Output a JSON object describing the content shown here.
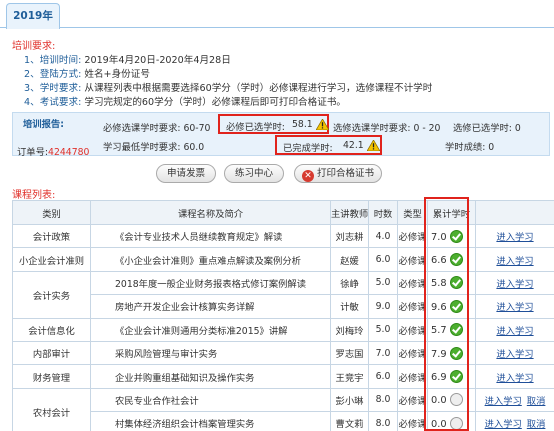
{
  "tab": {
    "label": "2019年"
  },
  "requirements": {
    "title": "培训要求:",
    "items": [
      {
        "label": "1、培训时间:",
        "value": " 2019年4月20日-2020年4月28日"
      },
      {
        "label": "2、登陆方式:",
        "value": " 姓名+身份证号"
      },
      {
        "label": "3、学时要求:",
        "value": " 从课程列表中根据需要选择60学分（学时）必修课程进行学习，选修课程不计学时"
      },
      {
        "label": "4、考试要求:",
        "value": " 学习完规定的60学分（学时）必修课程后即可打印合格证书。"
      }
    ]
  },
  "report": {
    "label": "培训报告:",
    "order_label": "订单号:",
    "order_number": "4244780",
    "required_select_req": "必修选课学时要求: 60-70",
    "required_selected_label": "必修已选学时:",
    "required_selected_value": "58.1",
    "elective_select_req": "选修选课学时要求: 0 - 20",
    "elective_selected": "选修已选学时: 0",
    "min_credits": "学习最低学时要求:  60.0",
    "completed_label": "已完成学时:",
    "completed_value": "42.1",
    "score": "学时成绩:  0"
  },
  "buttons": {
    "invoice": "申请发票",
    "practice": "练习中心",
    "print": "打印合格证书"
  },
  "list": {
    "title": "课程列表:",
    "headers": [
      "类别",
      "课程名称及简介",
      "主讲教师",
      "时数",
      "类型",
      "累计学时",
      ""
    ],
    "rows": [
      {
        "category": "会计政策",
        "name": "《会计专业技术人员继续教育规定》解读",
        "teacher": "刘志耕",
        "time": "4.0",
        "type": "必修课",
        "hours": "7.0",
        "done": true,
        "action": "进入学习",
        "cancel": ""
      },
      {
        "category": "小企业会计准则",
        "name": "《小企业会计准则》重点难点解读及案例分析",
        "teacher": "赵媛",
        "time": "6.0",
        "type": "必修课",
        "hours": "6.6",
        "done": true,
        "action": "进入学习",
        "cancel": ""
      },
      {
        "category": "会计实务",
        "name": "2018年度一般企业财务报表格式修订案例解读",
        "teacher": "徐峥",
        "time": "5.0",
        "type": "必修课",
        "hours": "5.8",
        "done": true,
        "action": "进入学习",
        "cancel": ""
      },
      {
        "category": "",
        "name": "房地产开发企业会计核算实务详解",
        "teacher": "计敏",
        "time": "9.0",
        "type": "必修课",
        "hours": "9.6",
        "done": true,
        "action": "进入学习",
        "cancel": ""
      },
      {
        "category": "会计信息化",
        "name": "《企业会计准则通用分类标准2015》讲解",
        "teacher": "刘梅玲",
        "time": "5.0",
        "type": "必修课",
        "hours": "5.7",
        "done": true,
        "action": "进入学习",
        "cancel": ""
      },
      {
        "category": "内部审计",
        "name": "采购风险管理与审计实务",
        "teacher": "罗志国",
        "time": "7.0",
        "type": "必修课",
        "hours": "7.9",
        "done": true,
        "action": "进入学习",
        "cancel": ""
      },
      {
        "category": "财务管理",
        "name": "企业并购重组基础知识及操作实务",
        "teacher": "王竞宇",
        "time": "6.0",
        "type": "必修课",
        "hours": "6.9",
        "done": true,
        "action": "进入学习",
        "cancel": ""
      },
      {
        "category": "农村会计",
        "name": "农民专业合作社会计",
        "teacher": "彭小琳",
        "time": "8.0",
        "type": "必修课",
        "hours": "0.0",
        "done": false,
        "action": "进入学习",
        "cancel": "取消"
      },
      {
        "category": "",
        "name": "村集体经济组织会计档案管理实务",
        "teacher": "曹文莉",
        "time": "8.0",
        "type": "必修课",
        "hours": "0.0",
        "done": false,
        "action": "进入学习",
        "cancel": "取消"
      }
    ]
  },
  "colors": {
    "accent_blue": "#1f5e99",
    "alert_red": "#e0231c",
    "ok_green": "#4cae2e"
  },
  "icons": {
    "warning": "warning-icon",
    "done": "check-circle-icon",
    "pending": "empty-circle-icon",
    "print": "print-icon"
  }
}
